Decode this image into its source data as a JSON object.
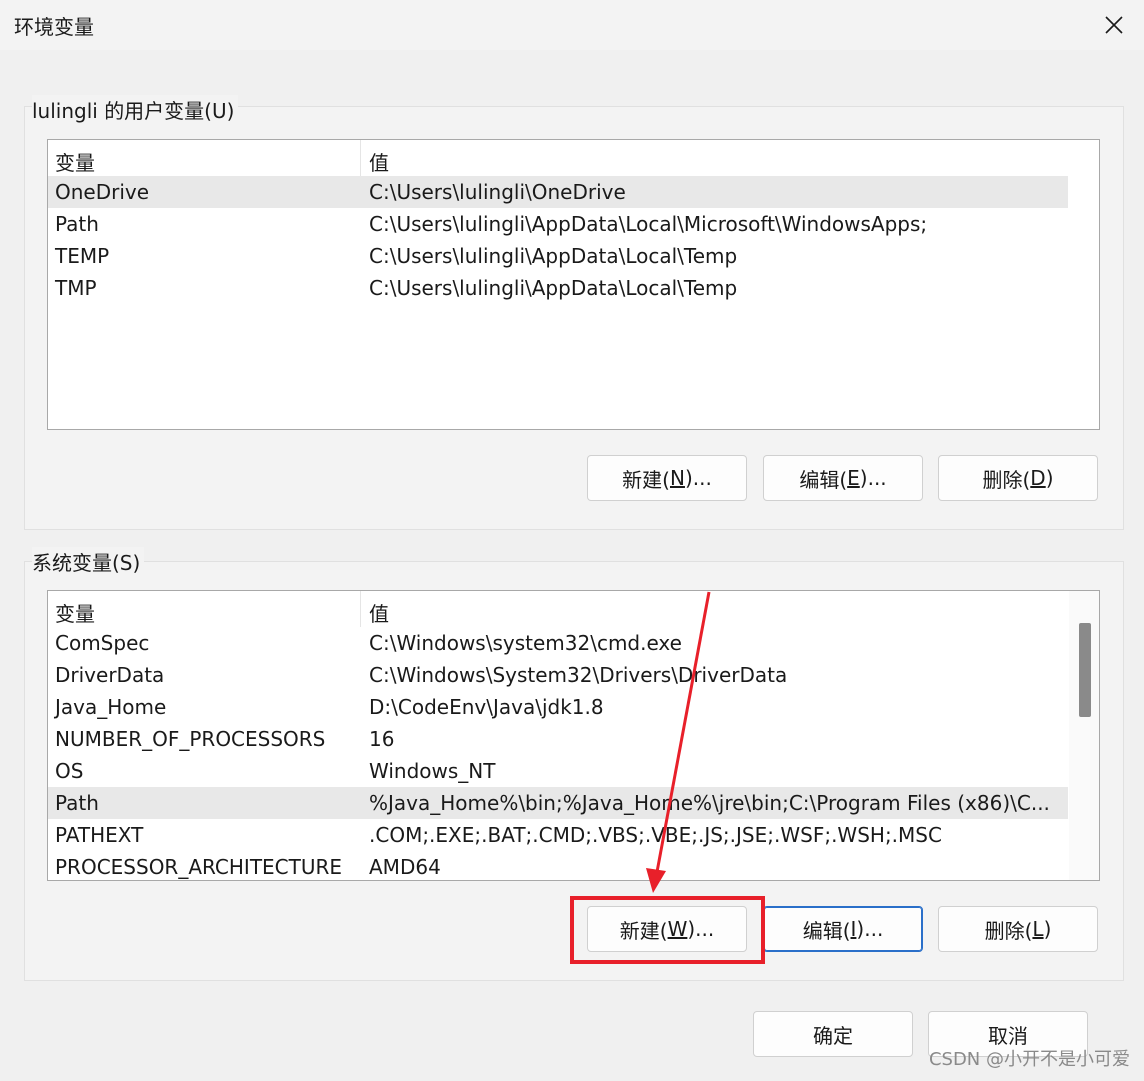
{
  "window": {
    "title": "环境变量"
  },
  "user_vars": {
    "title": "lulingli 的用户变量(U)",
    "header": {
      "name": "变量",
      "value": "值"
    },
    "rows": [
      {
        "name": "OneDrive",
        "value": "C:\\Users\\lulingli\\OneDrive"
      },
      {
        "name": "Path",
        "value": "C:\\Users\\lulingli\\AppData\\Local\\Microsoft\\WindowsApps;"
      },
      {
        "name": "TEMP",
        "value": "C:\\Users\\lulingli\\AppData\\Local\\Temp"
      },
      {
        "name": "TMP",
        "value": "C:\\Users\\lulingli\\AppData\\Local\\Temp"
      }
    ],
    "buttons": {
      "new_pre": "新建(",
      "new_key": "N",
      "new_post": ")...",
      "edit_pre": "编辑(",
      "edit_key": "E",
      "edit_post": ")...",
      "delete_pre": "删除(",
      "delete_key": "D",
      "delete_post": ")"
    }
  },
  "system_vars": {
    "title": "系统变量(S)",
    "header": {
      "name": "变量",
      "value": "值"
    },
    "rows": [
      {
        "name": "ComSpec",
        "value": "C:\\Windows\\system32\\cmd.exe"
      },
      {
        "name": "DriverData",
        "value": "C:\\Windows\\System32\\Drivers\\DriverData"
      },
      {
        "name": "Java_Home",
        "value": "D:\\CodeEnv\\Java\\jdk1.8"
      },
      {
        "name": "NUMBER_OF_PROCESSORS",
        "value": "16"
      },
      {
        "name": "OS",
        "value": "Windows_NT"
      },
      {
        "name": "Path",
        "value": "%Java_Home%\\bin;%Java_Home%\\jre\\bin;C:\\Program Files (x86)\\C..."
      },
      {
        "name": "PATHEXT",
        "value": ".COM;.EXE;.BAT;.CMD;.VBS;.VBE;.JS;.JSE;.WSF;.WSH;.MSC"
      },
      {
        "name": "PROCESSOR_ARCHITECTURE",
        "value": "AMD64"
      }
    ],
    "buttons": {
      "new_pre": "新建(",
      "new_key": "W",
      "new_post": ")...",
      "edit_pre": "编辑(",
      "edit_key": "I",
      "edit_post": ")...",
      "delete_pre": "删除(",
      "delete_key": "L",
      "delete_post": ")"
    }
  },
  "footer": {
    "ok_label": "确定",
    "cancel_label": "取消"
  },
  "watermark": "CSDN @小开不是小可爱",
  "colors": {
    "annotation_red": "#e8202a",
    "focus_blue": "#2a6fc9",
    "selected_row": "#e8e8e8"
  },
  "icons": {
    "close": "close-icon",
    "annotation": "red-arrow-icon"
  }
}
